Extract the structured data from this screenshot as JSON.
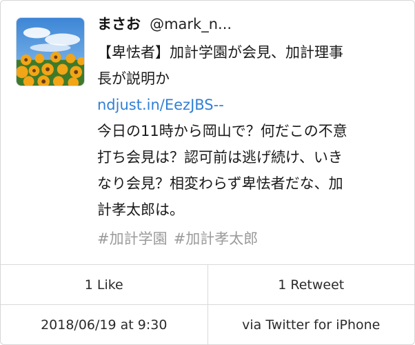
{
  "tweet": {
    "display_name": "まさお",
    "handle": "@mark_n...",
    "lines": [
      "【卑怯者】加計学園が会見、加計理事",
      "長が説明か"
    ],
    "link": "ndjust.in/EezJBS--",
    "comment_lines": [
      "今日の11時から岡山で？何だこの不意",
      "打ち会見は？認可前は逃げ続け、いき",
      "なり会見？相変わらず卑怯者だな、加",
      "計孝太郎は。"
    ],
    "hashtags": [
      "#加計学園",
      "#加計孝太郎"
    ]
  },
  "stats": {
    "likes": "1 Like",
    "retweets": "1 Retweet"
  },
  "meta": {
    "timestamp": "2018/06/19 at 9:30",
    "source": "via Twitter for iPhone"
  },
  "colors": {
    "link": "#2f7fd6",
    "hashtag": "#9a9a9a",
    "divider": "#d9d9d9"
  },
  "avatar_icon": "sunflower-field-photo"
}
